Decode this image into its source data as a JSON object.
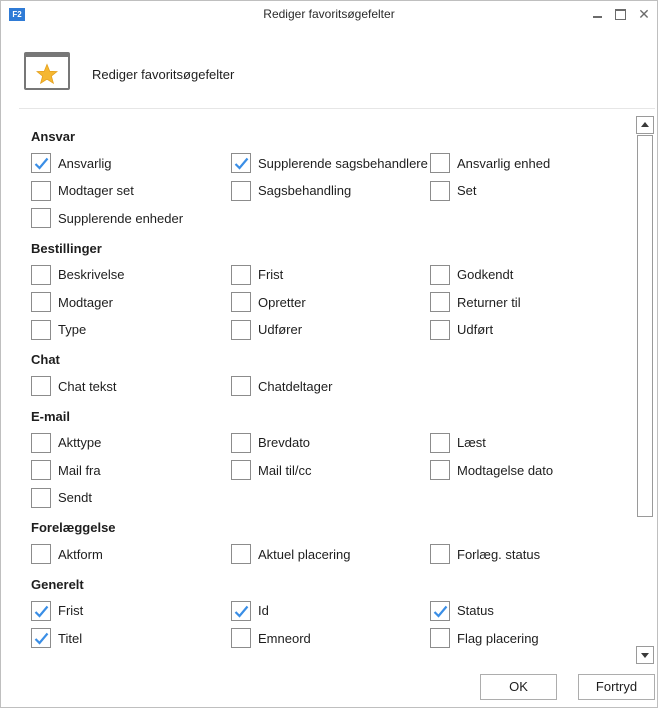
{
  "window": {
    "app_icon_text": "F2",
    "title": "Rediger favoritsøgefelter"
  },
  "header": {
    "title": "Rediger favoritsøgefelter",
    "icon": "star-icon"
  },
  "groups": [
    {
      "title": "Ansvar",
      "items": [
        {
          "label": "Ansvarlig",
          "checked": true
        },
        {
          "label": "Supplerende sagsbehandlere",
          "checked": true
        },
        {
          "label": "Ansvarlig enhed",
          "checked": false
        },
        {
          "label": "Modtager set",
          "checked": false
        },
        {
          "label": "Sagsbehandling",
          "checked": false
        },
        {
          "label": "Set",
          "checked": false
        },
        {
          "label": "Supplerende enheder",
          "checked": false
        }
      ]
    },
    {
      "title": "Bestillinger",
      "items": [
        {
          "label": "Beskrivelse",
          "checked": false
        },
        {
          "label": "Frist",
          "checked": false
        },
        {
          "label": "Godkendt",
          "checked": false
        },
        {
          "label": "Modtager",
          "checked": false
        },
        {
          "label": "Opretter",
          "checked": false
        },
        {
          "label": "Returner til",
          "checked": false
        },
        {
          "label": "Type",
          "checked": false
        },
        {
          "label": "Udfører",
          "checked": false
        },
        {
          "label": "Udført",
          "checked": false
        }
      ]
    },
    {
      "title": "Chat",
      "items": [
        {
          "label": "Chat tekst",
          "checked": false
        },
        {
          "label": "Chatdeltager",
          "checked": false
        }
      ]
    },
    {
      "title": "E-mail",
      "items": [
        {
          "label": "Akttype",
          "checked": false
        },
        {
          "label": "Brevdato",
          "checked": false
        },
        {
          "label": "Læst",
          "checked": false
        },
        {
          "label": "Mail fra",
          "checked": false
        },
        {
          "label": "Mail til/cc",
          "checked": false
        },
        {
          "label": "Modtagelse dato",
          "checked": false
        },
        {
          "label": "Sendt",
          "checked": false
        }
      ]
    },
    {
      "title": "Forelæggelse",
      "items": [
        {
          "label": "Aktform",
          "checked": false
        },
        {
          "label": "Aktuel placering",
          "checked": false
        },
        {
          "label": "Forlæg. status",
          "checked": false
        }
      ]
    },
    {
      "title": "Generelt",
      "items": [
        {
          "label": "Frist",
          "checked": true
        },
        {
          "label": "Id",
          "checked": true
        },
        {
          "label": "Status",
          "checked": true
        },
        {
          "label": "Titel",
          "checked": true
        },
        {
          "label": "Emneord",
          "checked": false
        },
        {
          "label": "Flag placering",
          "checked": false
        }
      ]
    }
  ],
  "buttons": {
    "ok": "OK",
    "cancel": "Fortryd"
  },
  "colors": {
    "checkmark": "#3a8ee6",
    "star": "#f5b731"
  }
}
